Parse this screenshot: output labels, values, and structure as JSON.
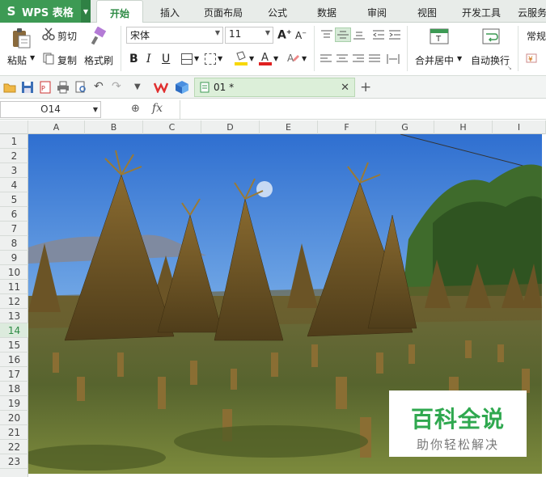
{
  "app": {
    "name": "WPS 表格"
  },
  "tabs": [
    {
      "label": "开始",
      "active": true
    },
    {
      "label": "插入"
    },
    {
      "label": "页面布局"
    },
    {
      "label": "公式"
    },
    {
      "label": "数据"
    },
    {
      "label": "审阅"
    },
    {
      "label": "视图"
    },
    {
      "label": "开发工具"
    },
    {
      "label": "云服务"
    }
  ],
  "ribbon": {
    "paste": "粘贴",
    "cut": "剪切",
    "copy": "复制",
    "format_painter": "格式刷",
    "font_name": "宋体",
    "font_size": "11",
    "merge_center": "合并居中",
    "wrap_text": "自动换行",
    "number_format": "常规"
  },
  "document": {
    "tab_title": "01 *"
  },
  "formula_bar": {
    "name_box": "O14",
    "fx": "fx"
  },
  "columns": [
    "A",
    "B",
    "C",
    "D",
    "E",
    "F",
    "G",
    "H",
    "I"
  ],
  "rows": [
    "1",
    "2",
    "3",
    "4",
    "5",
    "6",
    "7",
    "8",
    "9",
    "10",
    "11",
    "12",
    "13",
    "14",
    "15",
    "16",
    "17",
    "18",
    "19",
    "20",
    "21",
    "22",
    "23"
  ],
  "selected_row": "14",
  "watermark": {
    "title": "百科全说",
    "subtitle": "助你轻松解决"
  },
  "colors": {
    "brand": "#3d9a54",
    "accent": "#2e8b45"
  }
}
